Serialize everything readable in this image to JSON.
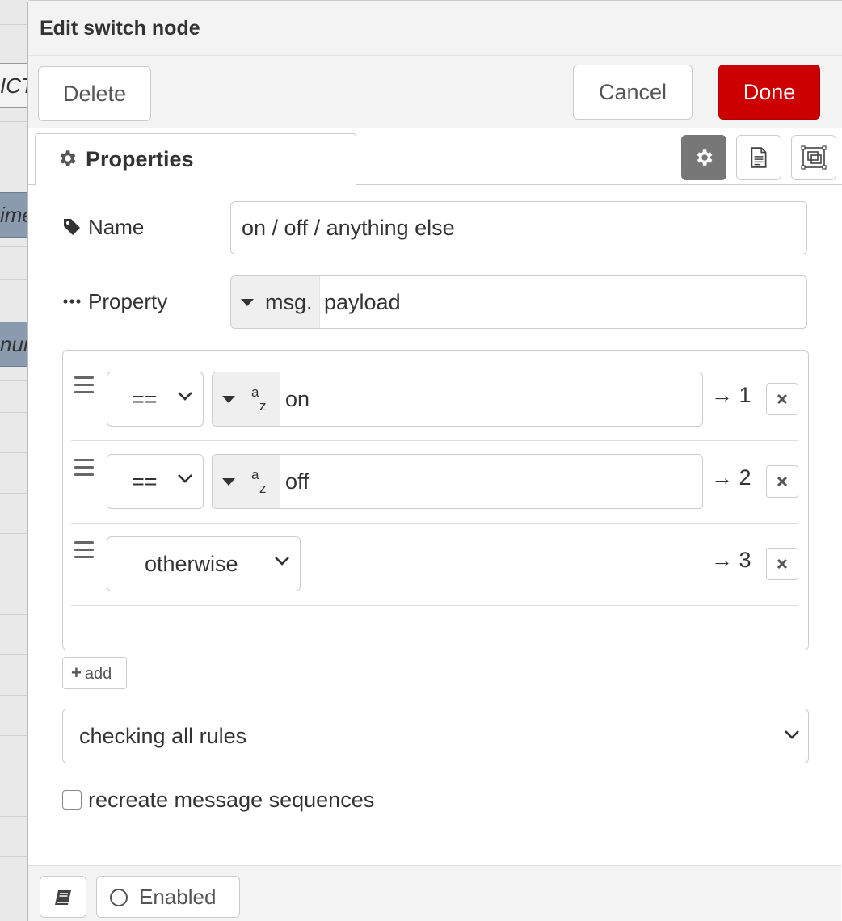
{
  "background": {
    "node_labels": [
      "ICT",
      "ime",
      "nur"
    ]
  },
  "dialog": {
    "title": "Edit switch node",
    "toolbar": {
      "delete_label": "Delete",
      "cancel_label": "Cancel",
      "done_label": "Done"
    },
    "tabs": {
      "properties_label": "Properties",
      "icons": [
        "gear-icon",
        "description-icon",
        "appearance-icon"
      ]
    },
    "fields": {
      "name_label": "Name",
      "name_value": "on / off / anything else",
      "property_label": "Property",
      "property_prefix": "msg.",
      "property_value": "payload"
    },
    "rules": [
      {
        "operator": "==",
        "type_icon": "string-type-icon",
        "value": "on",
        "output": "→ 1"
      },
      {
        "operator": "==",
        "type_icon": "string-type-icon",
        "value": "off",
        "output": "→ 2"
      },
      {
        "operator": "otherwise",
        "output": "→ 3"
      }
    ],
    "add_label": "add",
    "checking_mode": "checking all rules",
    "recreate_label": "recreate message sequences",
    "recreate_checked": false,
    "footer": {
      "enabled_label": "Enabled"
    }
  },
  "colors": {
    "done_button": "#cc0000",
    "active_tab_icon": "#777777"
  }
}
